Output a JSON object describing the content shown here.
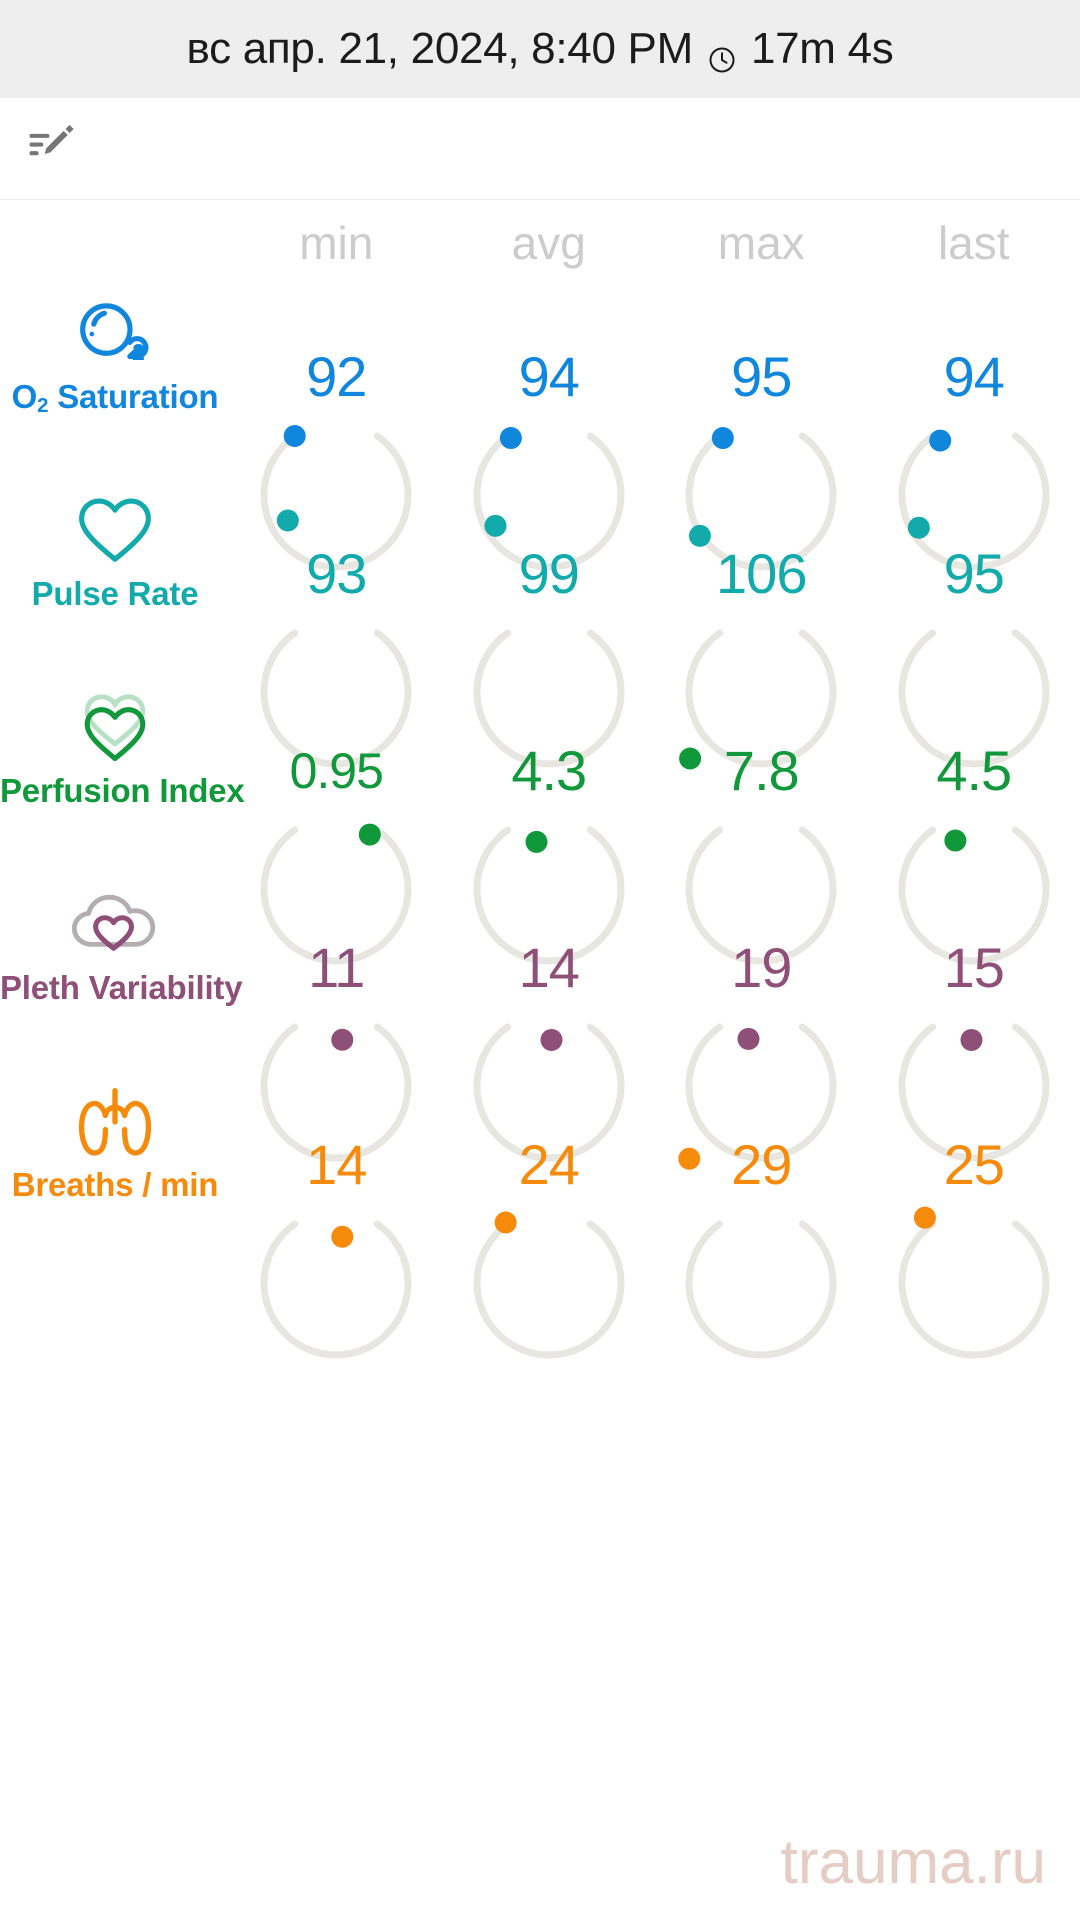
{
  "header": {
    "timestamp": "вс апр. 21, 2024, 8:40 PM",
    "clock_icon": "clock-icon",
    "duration": "17m 4s"
  },
  "toolbar": {
    "edit_note_icon": "edit-note-icon"
  },
  "columns": [
    "min",
    "avg",
    "max",
    "last"
  ],
  "colors": {
    "o2": "#1186dd",
    "pulse": "#12aaaa",
    "perfusion": "#11983b",
    "pleth": "#8e4f79",
    "breaths": "#f58a0b",
    "gauge_track": "#e8e6e0",
    "header_text": "#cccccc",
    "watermark": "#e6cdc4"
  },
  "metrics": [
    {
      "id": "o2-saturation",
      "name_main": "O",
      "name_sub": "2",
      "name_rest": " Saturation",
      "name_plain": "O2 Saturation",
      "icon": "oxygen-bubble-icon",
      "color": "#1186dd",
      "values": [
        "92",
        "94",
        "95",
        "94"
      ],
      "dot_angles": [
        55,
        58,
        58,
        62
      ],
      "scale_min": 0,
      "scale_max": 100
    },
    {
      "id": "pulse-rate",
      "name_main": "Pulse Rate",
      "name_sub": "",
      "name_rest": "",
      "name_plain": "Pulse Rate",
      "icon": "heart-icon",
      "color": "#12aaaa",
      "values": [
        "93",
        "99",
        "106",
        "95"
      ],
      "dot_angles": [
        -48,
        -42,
        -32,
        -40
      ],
      "scale_min": 0,
      "scale_max": 250
    },
    {
      "id": "perfusion-index",
      "name_main": "Perfusion Index",
      "name_sub": "",
      "name_rest": "",
      "name_plain": "Perfusion Index",
      "icon": "double-heart-icon",
      "color": "#11983b",
      "values": [
        "0.95",
        "4.3",
        "7.8",
        "4.5"
      ],
      "dot_angles": [
        118,
        80,
        -10,
        75
      ],
      "scale_min": 0,
      "scale_max": 20
    },
    {
      "id": "pleth-variability",
      "name_main": "Pleth Variability",
      "name_sub": "",
      "name_rest": "",
      "name_plain": "Pleth Variability",
      "icon": "cloud-heart-icon",
      "color": "#8e4f79",
      "values": [
        "11",
        "14",
        "19",
        "15"
      ],
      "dot_angles": [
        95,
        92,
        80,
        88
      ],
      "scale_min": 0,
      "scale_max": 100
    },
    {
      "id": "breaths-per-min",
      "name_main": "Breaths / min",
      "name_sub": "",
      "name_rest": "",
      "name_plain": "Breaths / min",
      "icon": "lungs-icon",
      "color": "#f58a0b",
      "values": [
        "14",
        "24",
        "29",
        "25"
      ],
      "dot_angles": [
        95,
        53,
        -5,
        47
      ],
      "scale_min": 0,
      "scale_max": 60
    }
  ],
  "watermark": "trauma.ru"
}
